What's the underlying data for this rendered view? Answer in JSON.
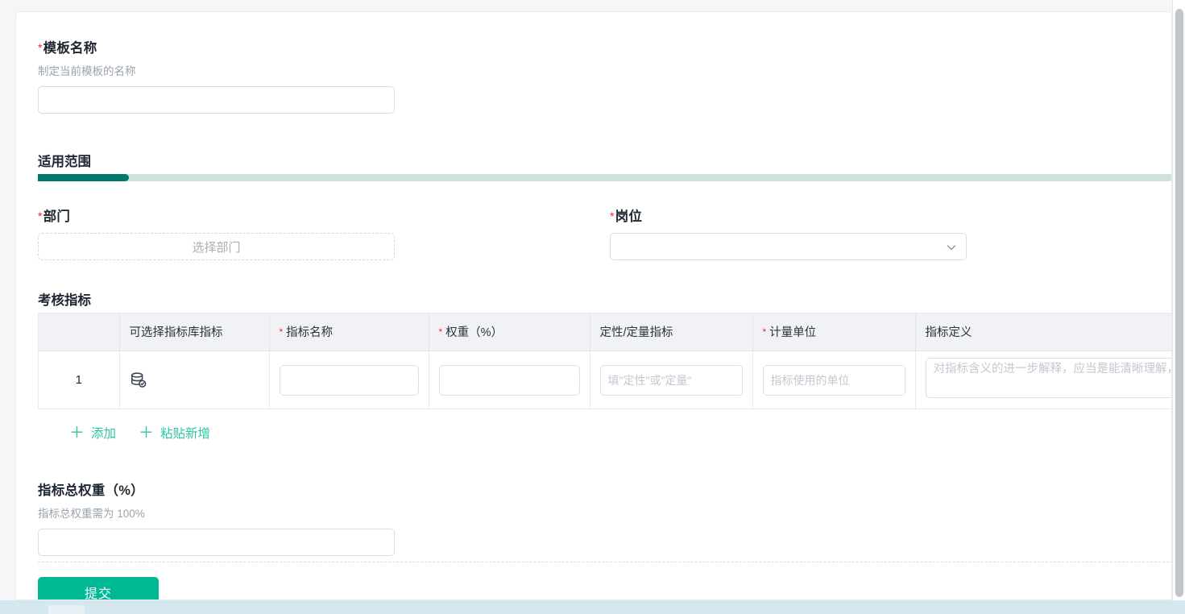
{
  "form": {
    "template_name": {
      "label": "模板名称",
      "required_mark": "*",
      "hint": "制定当前模板的名称",
      "value": "",
      "placeholder": ""
    },
    "scope": {
      "title": "适用范围",
      "progress_percent": 8
    },
    "department": {
      "label": "部门",
      "required_mark": "*",
      "picker_text": "选择部门"
    },
    "position": {
      "label": "岗位",
      "required_mark": "*",
      "value": "",
      "chevron_icon": "chevron-down-icon"
    },
    "kpi": {
      "title": "考核指标",
      "columns": [
        {
          "label": "",
          "required": false
        },
        {
          "label": "可选择指标库指标",
          "required": false
        },
        {
          "label": "指标名称",
          "required": true
        },
        {
          "label": "权重（%）",
          "required": true
        },
        {
          "label": "定性/定量指标",
          "required": false
        },
        {
          "label": "计量单位",
          "required": true
        },
        {
          "label": "指标定义",
          "required": false
        }
      ],
      "rows": [
        {
          "index": "1",
          "library_icon": "database-check-icon",
          "name_value": "",
          "name_placeholder": "",
          "weight_value": "",
          "weight_placeholder": "",
          "type_value": "",
          "type_placeholder": "填\"定性\"或\"定量\"",
          "unit_value": "",
          "unit_placeholder": "指标使用的单位",
          "definition_value": "",
          "definition_placeholder": "对指标含义的进一步解释，应当是能清晰理解，不会产生歧义的"
        }
      ],
      "actions": [
        {
          "icon": "plus-icon",
          "label": "添加"
        },
        {
          "icon": "plus-icon",
          "label": "粘贴新增"
        }
      ]
    },
    "total_weight": {
      "label": "指标总权重（%）",
      "hint": "指标总权重需为 100%",
      "value": "",
      "placeholder": ""
    },
    "submit": {
      "label": "提交"
    }
  },
  "colors": {
    "accent_teal": "#00b894",
    "progress_fill": "#017a6d",
    "progress_track": "#cfe1de",
    "required_red": "#f5222d",
    "link_teal": "#2ec4a6",
    "header_bg": "#f0f2f5",
    "footer_strip": "#d6e8ef"
  }
}
